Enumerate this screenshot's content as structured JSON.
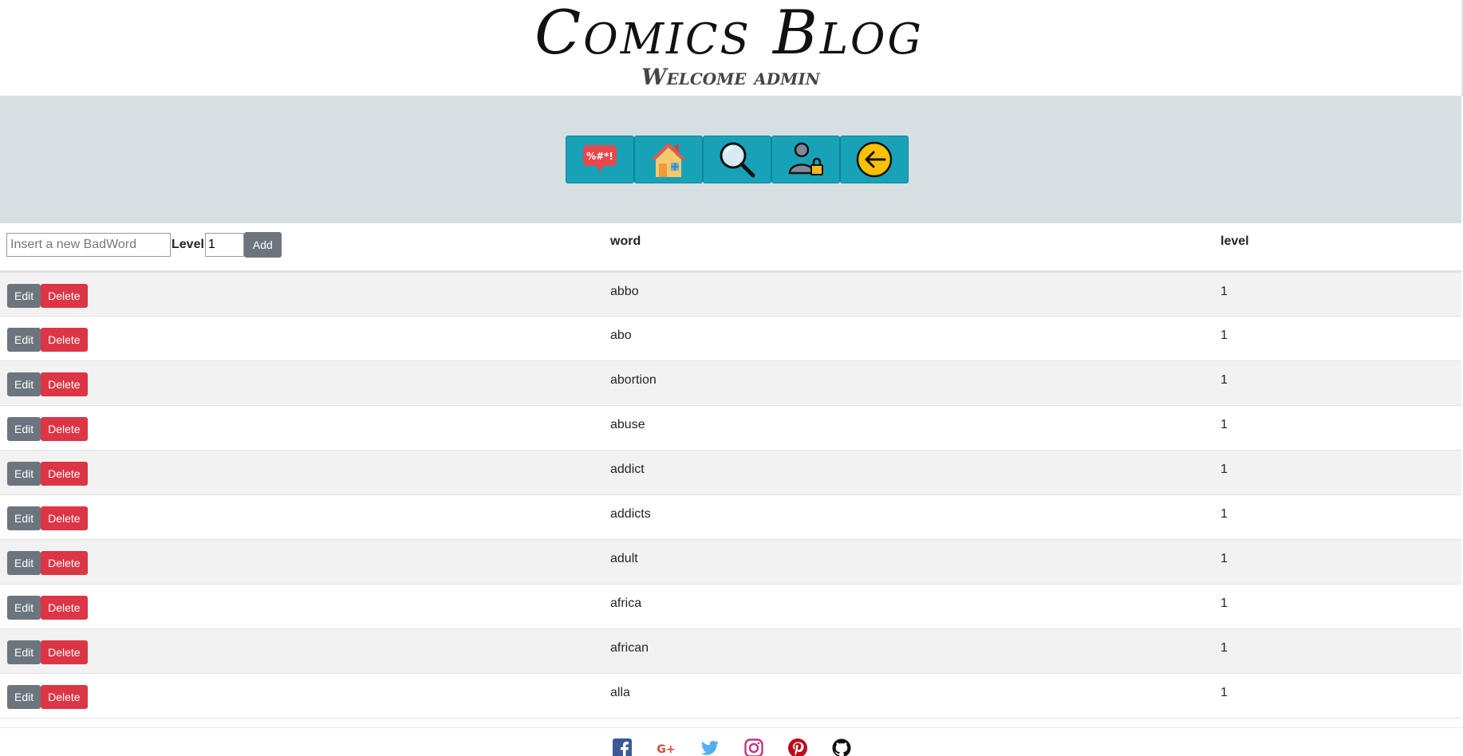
{
  "header": {
    "title": "Comics Blog",
    "welcome": "Welcome admin"
  },
  "nav": {
    "items": [
      {
        "icon": "swear-speech-bubble-icon",
        "symbols": "%#*!"
      },
      {
        "icon": "home-icon"
      },
      {
        "icon": "search-icon"
      },
      {
        "icon": "user-lock-icon"
      },
      {
        "icon": "logout-icon"
      }
    ],
    "accent": "#17a2b8",
    "band_color": "#d6e0e2"
  },
  "table": {
    "add_form": {
      "placeholder": "Insert a new BadWord",
      "level_label": "Level",
      "level_value": "1",
      "add_label": "Add"
    },
    "columns": [
      "word",
      "level"
    ],
    "edit_label": "Edit",
    "delete_label": "Delete",
    "rows": [
      {
        "word": "abbo",
        "level": "1"
      },
      {
        "word": "abo",
        "level": "1"
      },
      {
        "word": "abortion",
        "level": "1"
      },
      {
        "word": "abuse",
        "level": "1"
      },
      {
        "word": "addict",
        "level": "1"
      },
      {
        "word": "addicts",
        "level": "1"
      },
      {
        "word": "adult",
        "level": "1"
      },
      {
        "word": "africa",
        "level": "1"
      },
      {
        "word": "african",
        "level": "1"
      },
      {
        "word": "alla",
        "level": "1"
      }
    ]
  },
  "footer": {
    "icons": [
      "facebook-icon",
      "google-plus-icon",
      "twitter-icon",
      "instagram-icon",
      "pinterest-icon",
      "github-icon"
    ],
    "google_plus_text": "G+"
  },
  "colors": {
    "secondary": "#6c757d",
    "danger": "#dc3545"
  }
}
